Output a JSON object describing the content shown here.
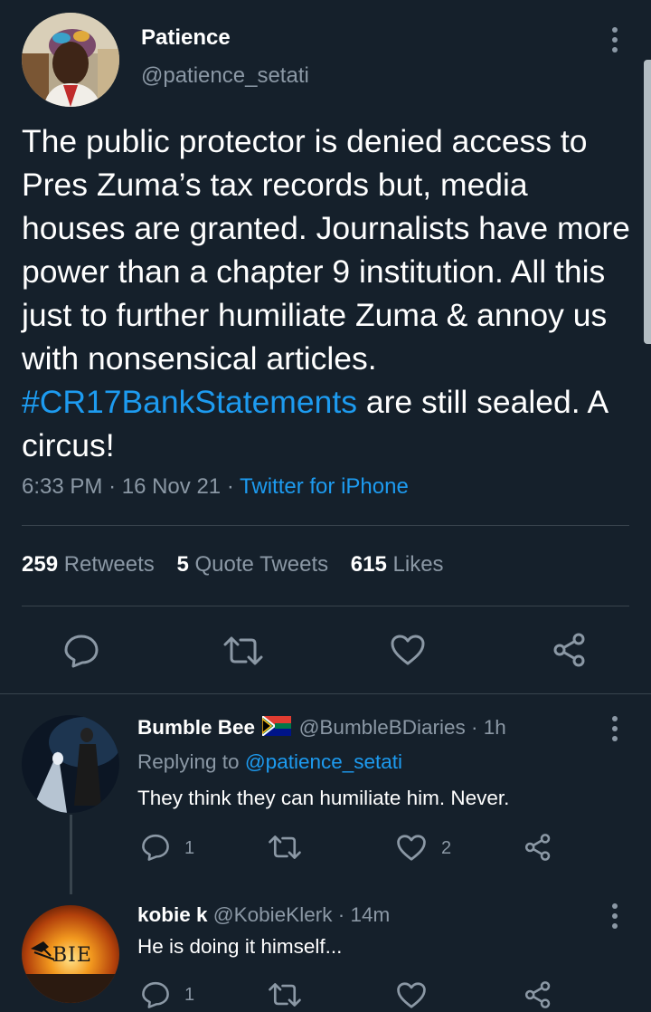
{
  "main_tweet": {
    "author_name": "Patience",
    "author_handle": "@patience_setati",
    "text_before_tag": "The public protector is denied access to Pres Zuma’s tax records but, media houses are granted. Journalists have more power than a chapter 9 institution. All this just to further humiliate Zuma & annoy us with nonsensical articles.",
    "hashtag": "#CR17BankStatements",
    "text_after_tag": " are still sealed. A circus!",
    "time": "6:33 PM",
    "date": "16 Nov 21",
    "source": "Twitter for iPhone",
    "stats": {
      "retweets_count": "259",
      "retweets_label": "Retweets",
      "quotes_count": "5",
      "quotes_label": "Quote Tweets",
      "likes_count": "615",
      "likes_label": "Likes"
    }
  },
  "replies": [
    {
      "author_name": "Bumble Bee",
      "flag_icon": "south-africa-flag-icon",
      "author_handle": "@BumbleBDiaries",
      "time": "1h",
      "replying_label": "Replying to",
      "replying_handle": "@patience_setati",
      "text": "They think they can humiliate him. Never.",
      "reply_count": "1",
      "like_count": "2"
    },
    {
      "author_name": "kobie k",
      "author_handle": "@KobieKlerk",
      "time": "14m",
      "text": "He is doing it himself...",
      "reply_count": "1",
      "avatar_text": "BIE"
    }
  ],
  "separator": "·",
  "colors": {
    "background": "#15202b",
    "text": "#ffffff",
    "muted": "#8b98a5",
    "accent": "#1d9bf0",
    "divider": "#38444d"
  }
}
